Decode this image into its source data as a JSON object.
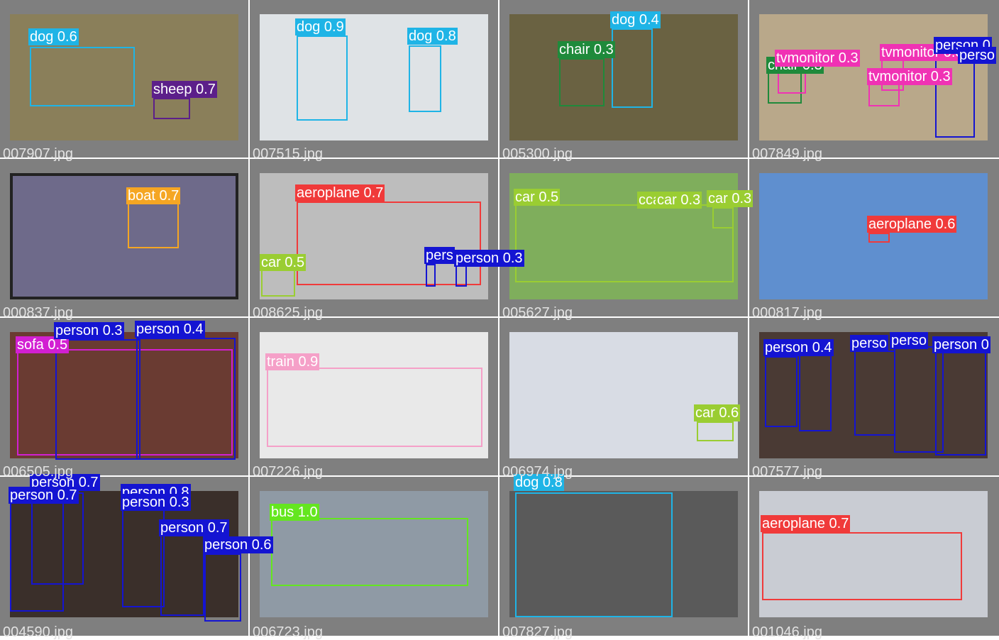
{
  "colors": {
    "dog": "#1fb4e6",
    "sheep": "#5c1f8a",
    "chair": "#1f8a3b",
    "tvmonitor": "#f032b4",
    "person": "#1414d2",
    "boat": "#f5a623",
    "aeroplane": "#f03a3a",
    "car": "#9acd32",
    "sofa": "#d21fd2",
    "train": "#f5a0c8",
    "bus": "#64e61f"
  },
  "tiles": [
    {
      "file": "007907.jpg",
      "photo": "#8a7f5a",
      "labels": [
        "dog 0.6",
        "sheep 0.7"
      ]
    },
    {
      "file": "007515.jpg",
      "photo": "#dfe3e6",
      "labels": [
        "dog 0.9",
        "dog 0.8"
      ]
    },
    {
      "file": "005300.jpg",
      "photo": "#6a6242",
      "labels": [
        "dog 0.4",
        "chair 0.3"
      ]
    },
    {
      "file": "007849.jpg",
      "photo": "#b9a88a",
      "labels": [
        "tvmonitor 0.3",
        "tvmonitor 0.3",
        "tvmonitor 0.3",
        "chair 0.3",
        "person 0",
        "perso"
      ]
    },
    {
      "file": "000837.jpg",
      "photo": "#6e6a8a",
      "labels": [
        "boat 0.7"
      ]
    },
    {
      "file": "008625.jpg",
      "photo": "#bdbdbd",
      "labels": [
        "aeroplane 0.7",
        "car 0.5",
        "pers",
        "person 0.3"
      ]
    },
    {
      "file": "005627.jpg",
      "photo": "#7fae5c",
      "labels": [
        "car 0.5",
        "car 0.3",
        "car 0.3",
        "cca"
      ]
    },
    {
      "file": "000817.jpg",
      "photo": "#5f8fcf",
      "labels": [
        "aeroplane 0.6"
      ]
    },
    {
      "file": "006505.jpg",
      "photo": "#6a3b32",
      "labels": [
        "sofa 0.5",
        "person 0.3",
        "person 0.4"
      ]
    },
    {
      "file": "007226.jpg",
      "photo": "#e9e9e9",
      "labels": [
        "train 0.9"
      ]
    },
    {
      "file": "006974.jpg",
      "photo": "#d8dce4",
      "labels": [
        "car 0.6"
      ]
    },
    {
      "file": "007577.jpg",
      "photo": "#4a3a34",
      "labels": [
        "person 0.4",
        "perso",
        "perso",
        "person 0"
      ]
    },
    {
      "file": "004590.jpg",
      "photo": "#3a2f2a",
      "labels": [
        "person 0.7",
        "person 0.7",
        "person 0.8",
        "person 0.3",
        "person 0.7",
        "person 0.6"
      ]
    },
    {
      "file": "006723.jpg",
      "photo": "#8f9aa5",
      "labels": [
        "bus 1.0"
      ]
    },
    {
      "file": "007827.jpg",
      "photo": "#5a5a5a",
      "labels": [
        "dog 0.8"
      ]
    },
    {
      "file": "001046.jpg",
      "photo": "#c9ccd3",
      "labels": [
        "aeroplane 0.7"
      ]
    }
  ]
}
